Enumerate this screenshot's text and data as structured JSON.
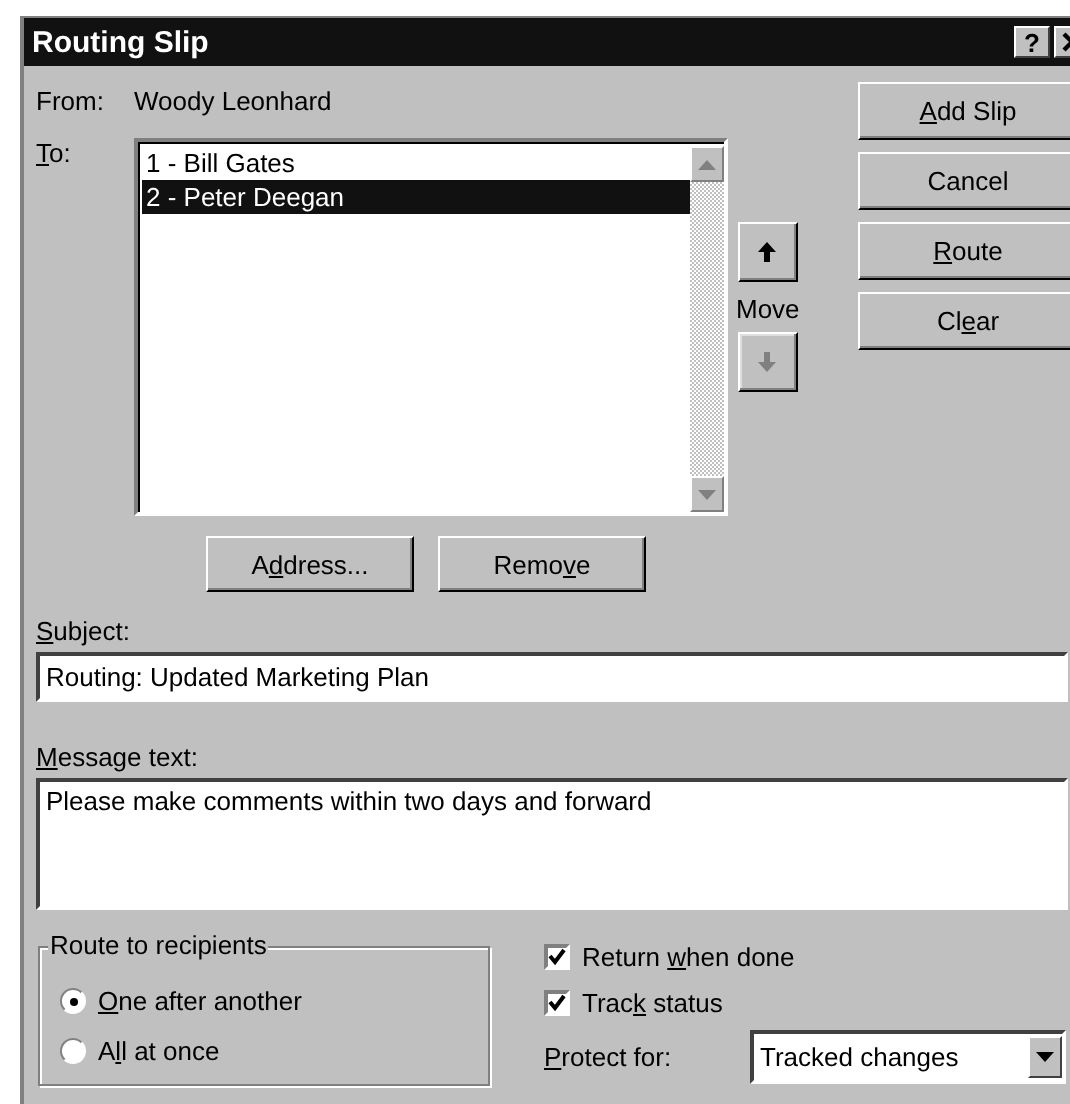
{
  "window": {
    "title": "Routing Slip",
    "help": "?"
  },
  "from": {
    "label": "From:",
    "value": "Woody Leonhard"
  },
  "to": {
    "label": {
      "key": "T",
      "post": "o:"
    },
    "recipients": [
      {
        "name": "1 - Bill Gates",
        "selected": false
      },
      {
        "name": "2 - Peter Deegan",
        "selected": true
      }
    ]
  },
  "move": {
    "label": "Move",
    "buttons": [
      {
        "kind": "up",
        "disabled": false
      },
      {
        "kind": "down",
        "disabled": true
      }
    ]
  },
  "buttons": [
    {
      "key": "A",
      "post": "dd Slip"
    },
    {
      "pre": "Cancel"
    },
    {
      "key": "R",
      "post": "oute"
    },
    {
      "pre": "Cl",
      "key": "e",
      "post": "ar"
    }
  ],
  "list_buttons": [
    {
      "pre": "A",
      "key": "d",
      "post": "dress..."
    },
    {
      "pre": "Remo",
      "key": "v",
      "post": "e"
    }
  ],
  "subject": {
    "label": {
      "key": "S",
      "post": "ubject:"
    },
    "value": "Routing: Updated Marketing Plan"
  },
  "message": {
    "label": {
      "key": "M",
      "post": "essage text:"
    },
    "value": "Please make comments within two days and forward"
  },
  "route": {
    "legend": "Route to recipients",
    "options": [
      {
        "key": "O",
        "post": "ne after another",
        "selected": true
      },
      {
        "pre": "A",
        "key": "l",
        "post": "l at once",
        "selected": false
      }
    ]
  },
  "checkboxes": [
    {
      "pre": "Return ",
      "key": "w",
      "post": "hen done",
      "checked": true
    },
    {
      "pre": "Trac",
      "key": "k",
      "post": " status",
      "checked": true
    }
  ],
  "protect": {
    "label": {
      "key": "P",
      "post": "rotect for:"
    },
    "value": "Tracked changes"
  }
}
